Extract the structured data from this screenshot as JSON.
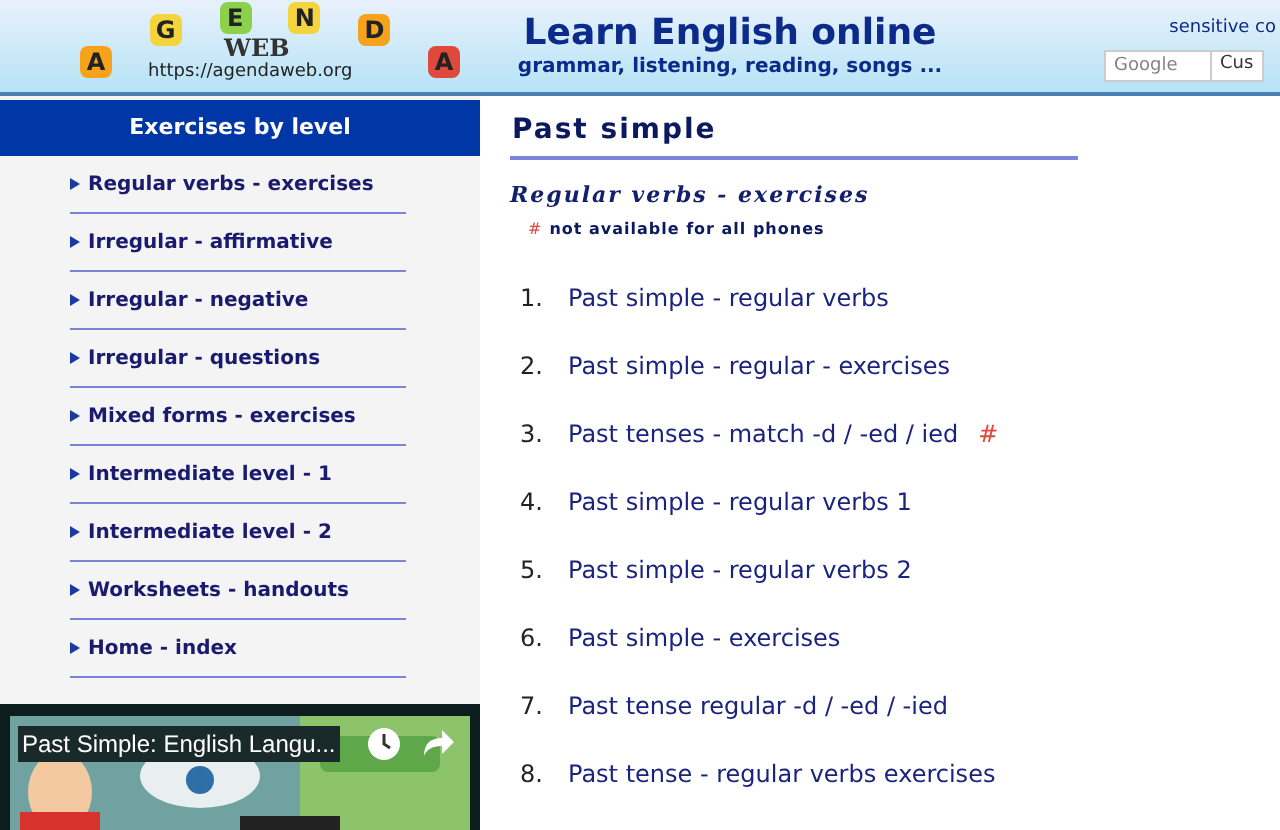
{
  "header": {
    "logo": {
      "letters": [
        "A",
        "G",
        "E",
        "N",
        "D",
        "A"
      ],
      "word": "WEB",
      "url": "https://agendaweb.org"
    },
    "title": "Learn English online",
    "subtitle": "grammar, listening, reading, songs ...",
    "search": {
      "label": "sensitive co",
      "placeholder": "Google",
      "button": "Cus"
    }
  },
  "sidebar": {
    "title": "Exercises by level",
    "items": [
      {
        "label": "Regular verbs - exercises"
      },
      {
        "label": "Irregular - affirmative"
      },
      {
        "label": "Irregular - negative"
      },
      {
        "label": "Irregular - questions"
      },
      {
        "label": "Mixed forms - exercises"
      },
      {
        "label": "Intermediate level - 1"
      },
      {
        "label": "Intermediate level - 2"
      },
      {
        "label": "Worksheets - handouts"
      },
      {
        "label": "Home - index"
      }
    ],
    "video": {
      "title": "Past Simple: English Langu..."
    }
  },
  "main": {
    "title": "Past simple",
    "subtitle": "Regular verbs - exercises",
    "note_mark": "#",
    "note": "not available for all phones",
    "exercises": [
      {
        "number": "1.",
        "label": "Past simple - regular verbs"
      },
      {
        "number": "2.",
        "label": "Past simple - regular - exercises"
      },
      {
        "number": "3.",
        "label": "Past tenses - match -d / -ed / ied",
        "mark": "#"
      },
      {
        "number": "4.",
        "label": "Past simple - regular verbs 1"
      },
      {
        "number": "5.",
        "label": "Past simple - regular verbs 2"
      },
      {
        "number": "6.",
        "label": "Past simple - exercises"
      },
      {
        "number": "7.",
        "label": "Past tense regular -d / -ed / -ied"
      },
      {
        "number": "8.",
        "label": "Past tense - regular verbs exercises"
      }
    ]
  }
}
